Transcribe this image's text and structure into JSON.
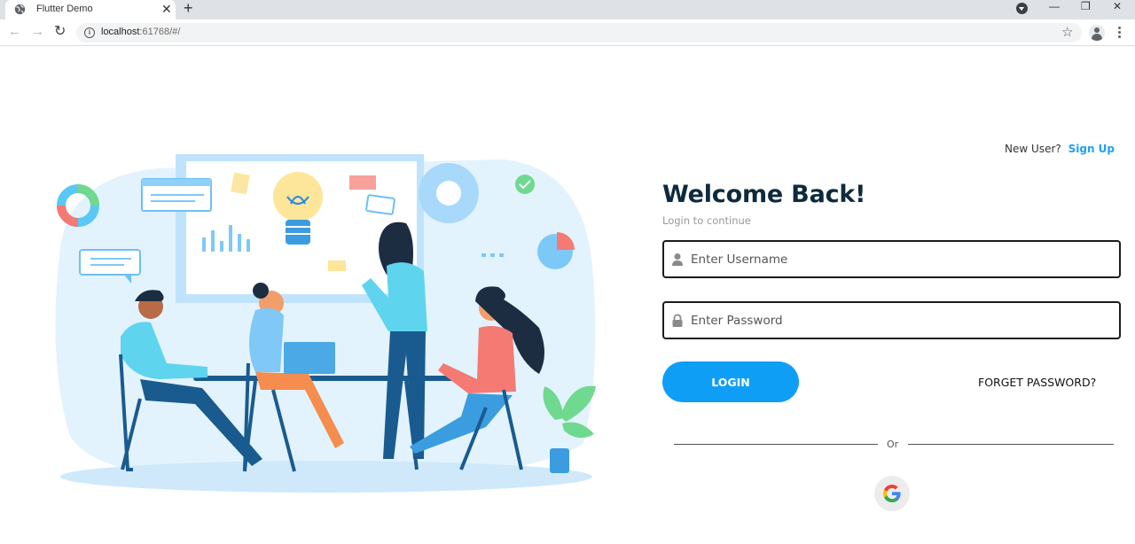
{
  "browser": {
    "tab_title": "Flutter Demo",
    "tab_close": "✕",
    "new_tab": "+",
    "url_host": "localhost",
    "url_path": ":61768/#/",
    "nav_back": "←",
    "nav_forward": "→",
    "nav_reload": "↻",
    "star": "☆",
    "window": {
      "minimize": "—",
      "restore": "❐",
      "close": "✕"
    }
  },
  "signup_prompt": {
    "label": "New User?",
    "link": "Sign Up"
  },
  "login": {
    "title": "Welcome Back!",
    "subtitle": "Login to continue",
    "username_placeholder": "Enter Username",
    "password_placeholder": "Enter Password",
    "login_button": "LOGIN",
    "forgot_link": "FORGET PASSWORD?",
    "divider_text": "Or"
  },
  "icons": {
    "username": "person-icon",
    "password": "lock-icon",
    "social": "google-icon"
  },
  "colors": {
    "primary": "#0f9ef6",
    "title": "#0e2a3d",
    "link": "#1da1f2",
    "field_border": "#1b1b1b"
  }
}
